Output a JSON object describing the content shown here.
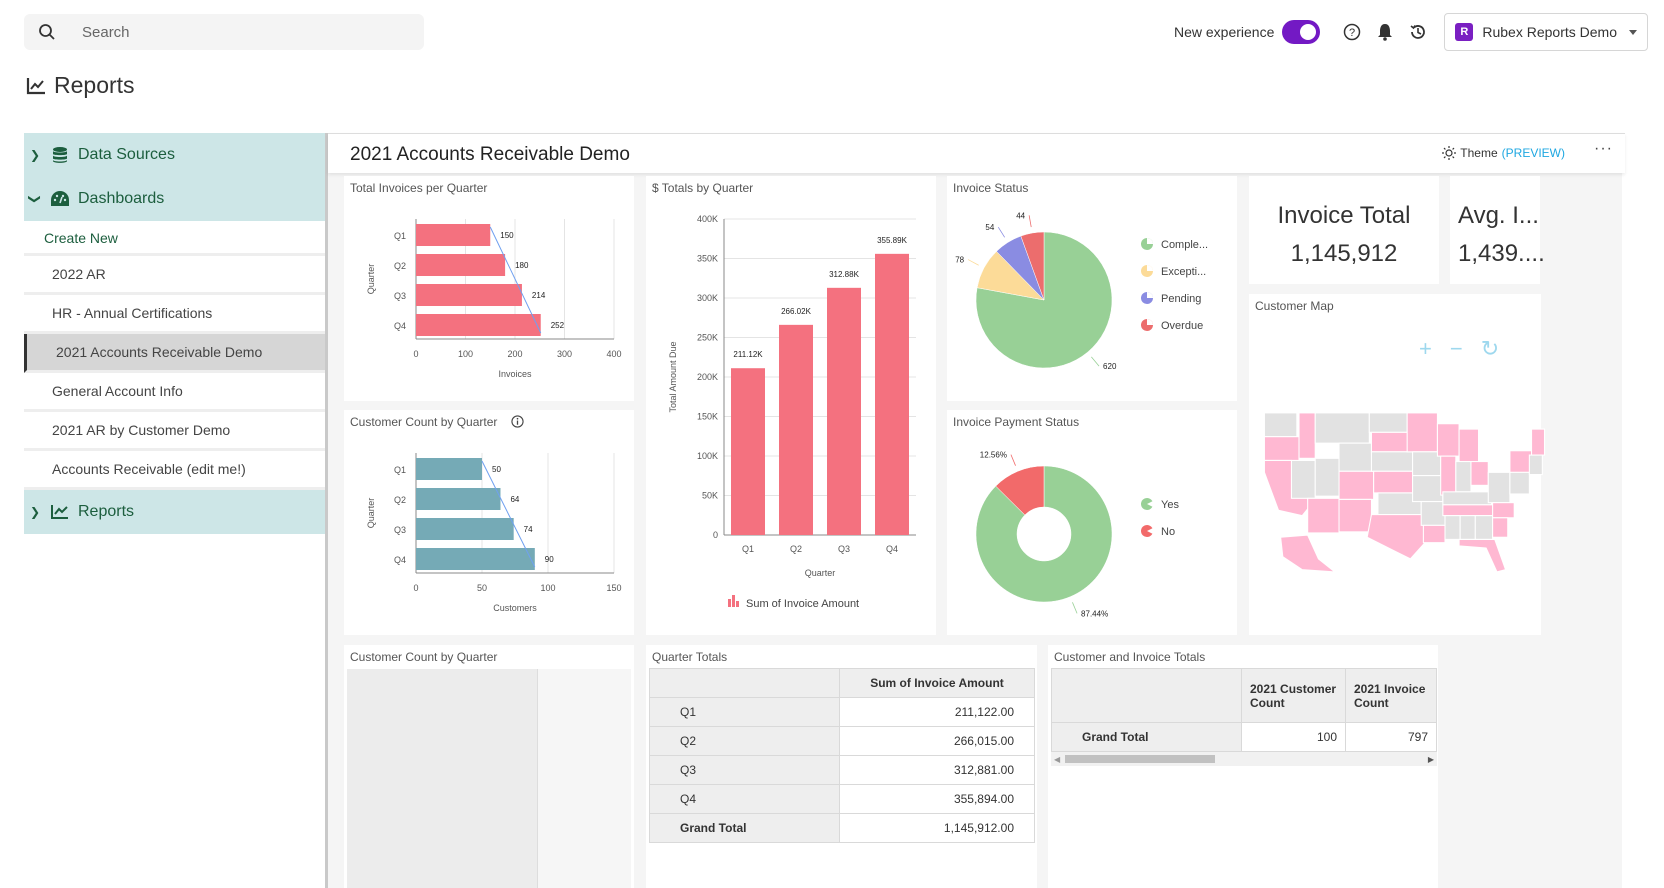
{
  "topbar": {
    "search_placeholder": "Search",
    "new_experience_label": "New experience",
    "new_experience_enabled": true,
    "org_initial": "R",
    "org_name": "Rubex Reports Demo"
  },
  "page": {
    "title": "Reports"
  },
  "sidebar": {
    "groups": [
      {
        "label": "Data Sources",
        "expanded": false
      },
      {
        "label": "Dashboards",
        "expanded": true
      },
      {
        "label": "Reports",
        "expanded": false
      }
    ],
    "create_new": "Create New",
    "items": [
      {
        "label": "2022 AR",
        "active": false
      },
      {
        "label": "HR - Annual Certifications",
        "active": false
      },
      {
        "label": "2021 Accounts Receivable Demo",
        "active": true
      },
      {
        "label": "General Account Info",
        "active": false
      },
      {
        "label": "2021 AR by Customer Demo",
        "active": false
      },
      {
        "label": "Accounts Receivable (edit me!)",
        "active": false
      }
    ]
  },
  "dashboard": {
    "title": "2021 Accounts Receivable Demo",
    "theme_label": "Theme",
    "theme_preview": "(PREVIEW)",
    "more_label": "···",
    "kpis": [
      {
        "title": "Invoice Total",
        "value": "1,145,912"
      },
      {
        "title": "Avg. I...",
        "value": "1,439...."
      }
    ],
    "map": {
      "title": "Customer Map",
      "zoom_in": "+",
      "zoom_out": "−",
      "reset": "↻"
    },
    "empty_tile_title": "Customer Count by Quarter",
    "quarter_totals": {
      "title": "Quarter Totals",
      "header": "Sum of Invoice Amount",
      "rows": [
        {
          "label": "Q1",
          "value": "211,122.00"
        },
        {
          "label": "Q2",
          "value": "266,015.00"
        },
        {
          "label": "Q3",
          "value": "312,881.00"
        },
        {
          "label": "Q4",
          "value": "355,894.00"
        },
        {
          "label": "Grand Total",
          "value": "1,145,912.00"
        }
      ]
    },
    "customer_invoice_totals": {
      "title": "Customer and Invoice Totals",
      "headers": [
        "2021 Customer Count",
        "2021 Invoice Count"
      ],
      "row_label": "Grand Total",
      "values": [
        "100",
        "797"
      ]
    }
  },
  "chart_data": [
    {
      "id": "invoices",
      "type": "bar",
      "orientation": "horizontal",
      "title": "Total Invoices per Quarter",
      "categories": [
        "Q1",
        "Q2",
        "Q3",
        "Q4"
      ],
      "values": [
        150,
        180,
        214,
        252
      ],
      "xlabel": "Invoices",
      "ylabel": "Quarter",
      "xlim": [
        0,
        400
      ],
      "ticks": [
        0,
        100,
        200,
        300,
        400
      ],
      "color": "#f4717f",
      "trendline": true
    },
    {
      "id": "customers",
      "type": "bar",
      "orientation": "horizontal",
      "title": "Customer Count by Quarter",
      "categories": [
        "Q1",
        "Q2",
        "Q3",
        "Q4"
      ],
      "values": [
        50,
        64,
        74,
        90
      ],
      "xlabel": "Customers",
      "ylabel": "Quarter",
      "xlim": [
        0,
        150
      ],
      "ticks": [
        0,
        50,
        100,
        150
      ],
      "color": "#75aab6",
      "trendline": true
    },
    {
      "id": "totals",
      "type": "bar",
      "orientation": "vertical",
      "title": "$ Totals by Quarter",
      "categories": [
        "Q1",
        "Q2",
        "Q3",
        "Q4"
      ],
      "values": [
        211122,
        266015,
        312881,
        355894
      ],
      "labels": [
        "211.12K",
        "266.02K",
        "312.88K",
        "355.89K"
      ],
      "xlabel": "Quarter",
      "ylabel": "Total Amount Due",
      "ylim": [
        0,
        400000
      ],
      "ticks": [
        "0",
        "50K",
        "100K",
        "150K",
        "200K",
        "250K",
        "300K",
        "350K",
        "400K"
      ],
      "legend": "Sum of Invoice Amount",
      "legend_position": "bottom",
      "color": "#f4717f"
    },
    {
      "id": "status",
      "type": "pie",
      "title": "Invoice Status",
      "slices": [
        {
          "label": "Comple...",
          "value": 620,
          "color": "#98d096"
        },
        {
          "label": "Excepti...",
          "value": 78,
          "color": "#fcdb98"
        },
        {
          "label": "Pending",
          "value": 54,
          "color": "#8a8ce2"
        },
        {
          "label": "Overdue",
          "value": 44,
          "color": "#ec6d6d"
        }
      ],
      "legend_position": "right"
    },
    {
      "id": "payment",
      "type": "pie",
      "donut": true,
      "title": "Invoice Payment Status",
      "slices": [
        {
          "label": "Yes",
          "value": 87.44,
          "display": "87.44%",
          "color": "#98d096"
        },
        {
          "label": "No",
          "value": 12.56,
          "display": "12.56%",
          "color": "#f26a6a"
        }
      ],
      "legend_position": "right"
    }
  ]
}
